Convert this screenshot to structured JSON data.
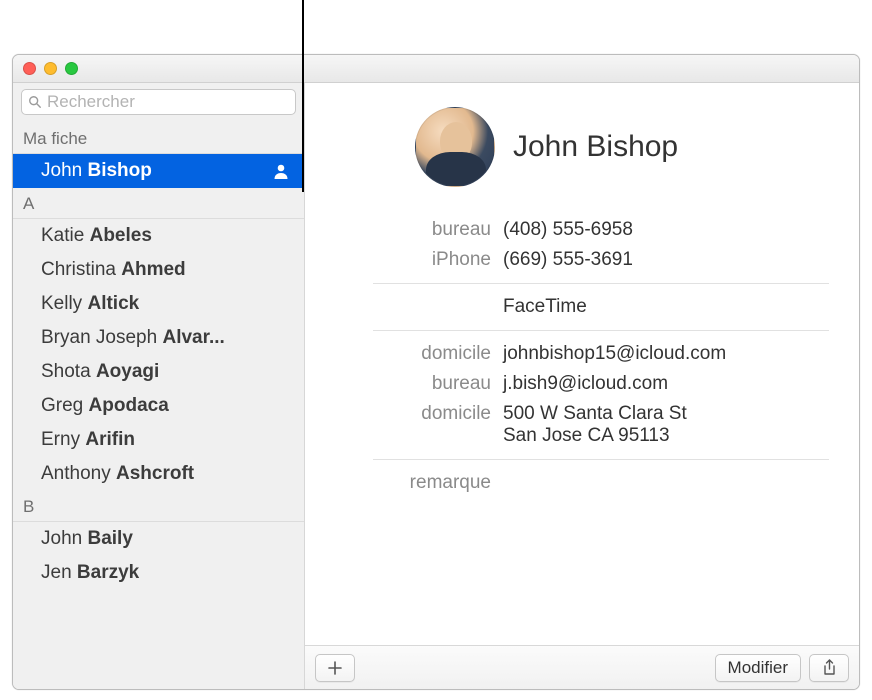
{
  "search": {
    "placeholder": "Rechercher"
  },
  "sidebar": {
    "my_card_header": "Ma fiche",
    "selected": {
      "first": "John",
      "last": "Bishop"
    },
    "sections": [
      {
        "letter": "A",
        "contacts": [
          {
            "first": "Katie",
            "last": "Abeles"
          },
          {
            "first": "Christina",
            "last": "Ahmed"
          },
          {
            "first": "Kelly",
            "last": "Altick"
          },
          {
            "first": "Bryan Joseph",
            "last": "Alvar..."
          },
          {
            "first": "Shota",
            "last": "Aoyagi"
          },
          {
            "first": "Greg",
            "last": "Apodaca"
          },
          {
            "first": "Erny",
            "last": "Arifin"
          },
          {
            "first": "Anthony",
            "last": "Ashcroft"
          }
        ]
      },
      {
        "letter": "B",
        "contacts": [
          {
            "first": "John",
            "last": "Baily"
          },
          {
            "first": "Jen",
            "last": "Barzyk"
          }
        ]
      }
    ]
  },
  "card": {
    "name": "John Bishop",
    "phones": [
      {
        "label": "bureau",
        "value": "(408) 555-6958"
      },
      {
        "label": "iPhone",
        "value": "(669) 555-3691"
      }
    ],
    "facetime_label": "FaceTime",
    "emails": [
      {
        "label": "domicile",
        "value": "johnbishop15@icloud.com"
      },
      {
        "label": "bureau",
        "value": "j.bish9@icloud.com"
      }
    ],
    "address": {
      "label": "domicile",
      "value": "500 W Santa Clara St\nSan Jose CA 95113"
    },
    "note_label": "remarque"
  },
  "toolbar": {
    "edit_label": "Modifier"
  }
}
